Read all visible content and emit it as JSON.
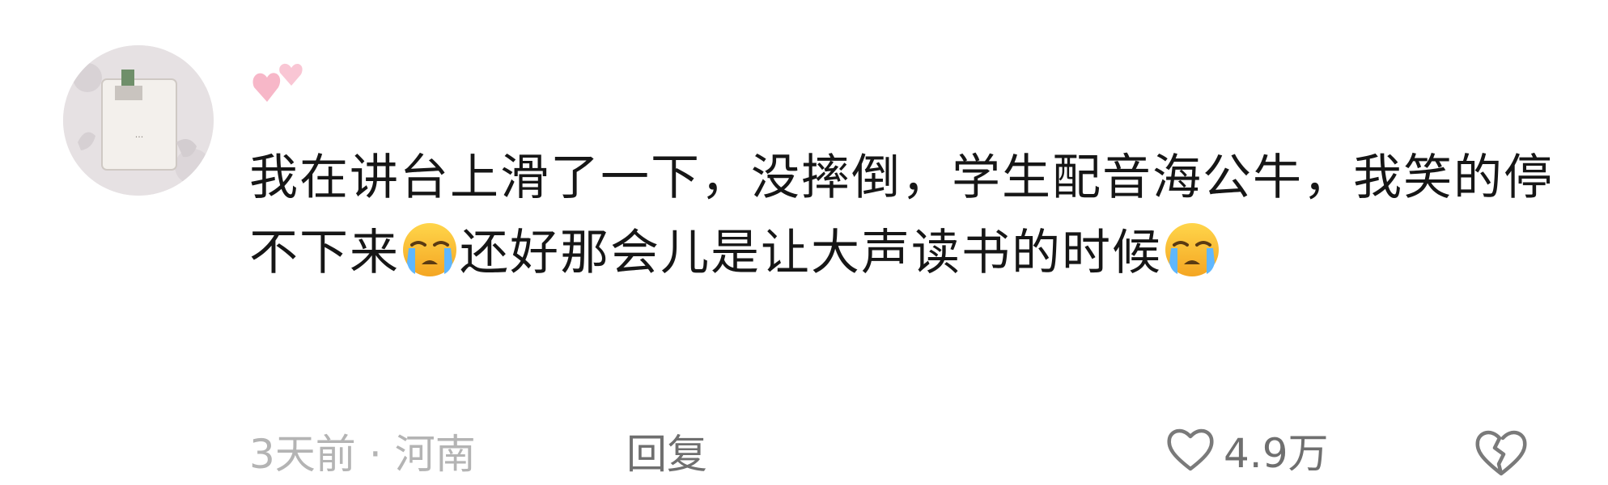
{
  "comment": {
    "text_parts": [
      "我在讲台上滑了一下，没摔倒，学生配音海公牛，我笑的停不下来",
      "还好那会儿是让大声读书的时候"
    ],
    "emoji": "loudly-crying-face",
    "time": "3天前",
    "separator": "·",
    "location": "河南",
    "reply_label": "回复",
    "like_count": "4.9万"
  },
  "icons": {
    "badge": "pink-hearts-icon",
    "like": "heart-outline-icon",
    "dislike": "broken-heart-icon"
  }
}
